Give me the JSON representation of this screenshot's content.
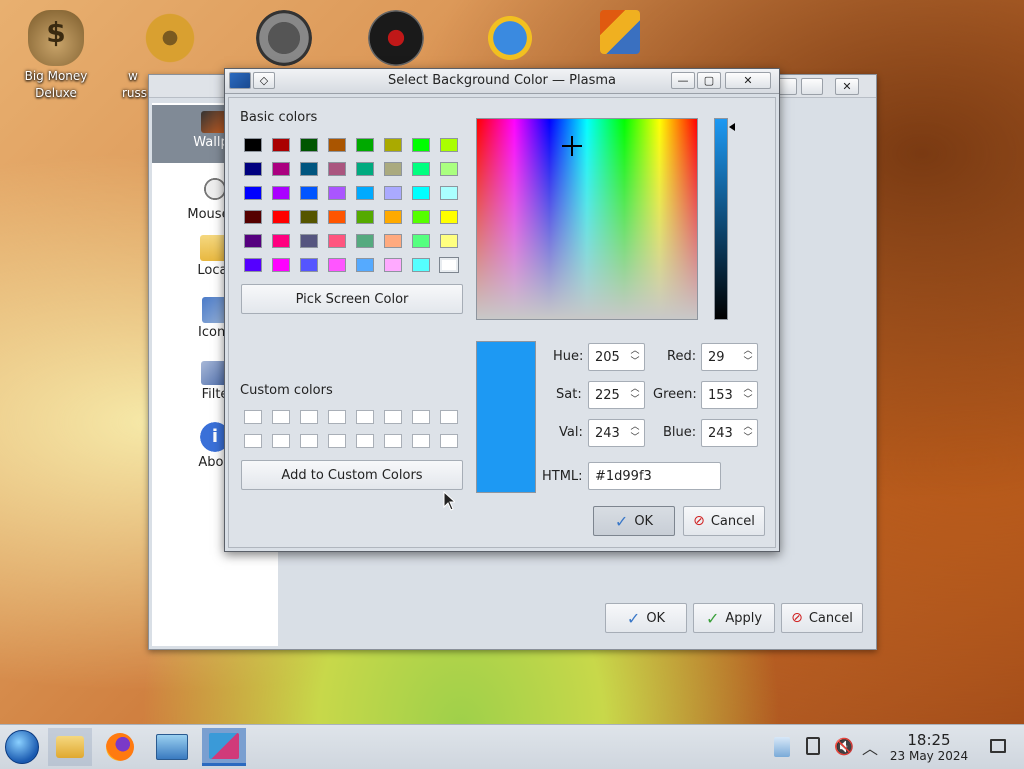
{
  "desktop": {
    "icons": [
      {
        "label": "Big Money\nDeluxe",
        "label1": "Big Money",
        "label2": "Deluxe"
      },
      {
        "label1": "w",
        "label2": "russ"
      },
      {
        "label1": ""
      },
      {
        "label1": ""
      },
      {
        "label1": ""
      },
      {
        "label1": ""
      }
    ]
  },
  "settings_window": {
    "sidebar": [
      {
        "label": "Wallpa"
      },
      {
        "label": "Mouse A"
      },
      {
        "label": "Locat"
      },
      {
        "label": "Icons"
      },
      {
        "label": "Filte"
      },
      {
        "label": "Abou"
      }
    ],
    "buttons": {
      "ok": "OK",
      "apply": "Apply",
      "cancel": "Cancel"
    }
  },
  "dialog": {
    "title": "Select Background Color — Plasma",
    "basic_colors_label": "Basic colors",
    "basic_colors": [
      [
        "#000000",
        "#aa0000",
        "#005500",
        "#aa5500",
        "#00aa00",
        "#aaaa00",
        "#00ff00",
        "#aaff00"
      ],
      [
        "#00007f",
        "#aa007f",
        "#00557f",
        "#aa557f",
        "#00aa7f",
        "#aaaa7f",
        "#00ff7f",
        "#aaff7f"
      ],
      [
        "#0000ff",
        "#aa00ff",
        "#0055ff",
        "#aa55ff",
        "#00aaff",
        "#aaaaff",
        "#00ffff",
        "#aaffff"
      ],
      [
        "#550000",
        "#ff0000",
        "#555500",
        "#ff5500",
        "#55aa00",
        "#ffaa00",
        "#55ff00",
        "#ffff00"
      ],
      [
        "#55007f",
        "#ff007f",
        "#55557f",
        "#ff557f",
        "#55aa7f",
        "#ffaa7f",
        "#55ff7f",
        "#ffff7f"
      ],
      [
        "#5500ff",
        "#ff00ff",
        "#5555ff",
        "#ff55ff",
        "#55aaff",
        "#ffaaff",
        "#55ffff",
        "#ffffff"
      ]
    ],
    "pick_screen_color": "Pick Screen Color",
    "custom_colors_label": "Custom colors",
    "add_to_custom": "Add to Custom Colors",
    "current_color": "#1d99f3",
    "fields": {
      "hue_label": "Hue:",
      "hue": "205",
      "sat_label": "Sat:",
      "sat": "225",
      "val_label": "Val:",
      "val": "243",
      "red_label": "Red:",
      "red": "29",
      "green_label": "Green:",
      "green": "153",
      "blue_label": "Blue:",
      "blue": "243",
      "html_label": "HTML:",
      "html": "#1d99f3"
    },
    "ok": "OK",
    "cancel": "Cancel"
  },
  "taskbar": {
    "clock_time": "18:25",
    "clock_date": "23 May 2024"
  }
}
